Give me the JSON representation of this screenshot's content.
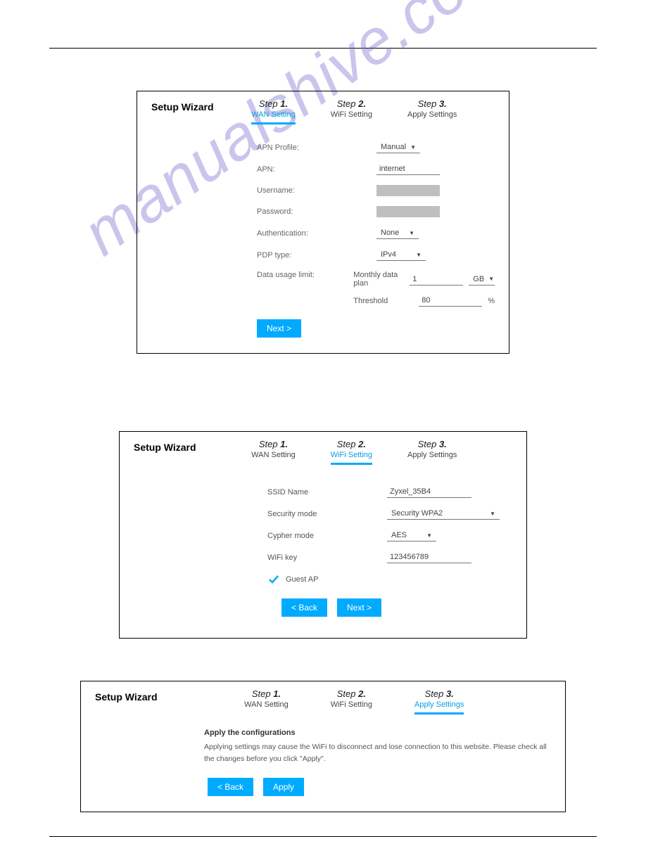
{
  "watermark": "manualshive.com",
  "wizard_title": "Setup Wizard",
  "steps": {
    "s1": {
      "label": "Step",
      "num": "1.",
      "sub": "WAN Setting"
    },
    "s2": {
      "label": "Step",
      "num": "2.",
      "sub": "WiFi Setting"
    },
    "s3": {
      "label": "Step",
      "num": "3.",
      "sub": "Apply Settings"
    }
  },
  "panel1": {
    "labels": {
      "apn_profile": "APN Profile:",
      "apn": "APN:",
      "username": "Username:",
      "password": "Password:",
      "auth": "Authentication:",
      "pdp": "PDP type:",
      "data_limit": "Data usage limit:",
      "monthly": "Monthly data plan",
      "threshold": "Threshold"
    },
    "values": {
      "apn_profile": "Manual",
      "apn": "internet",
      "auth": "None",
      "pdp": "IPv4",
      "monthly_value": "1",
      "monthly_unit": "GB",
      "threshold_value": "80",
      "threshold_unit": "%"
    },
    "next": "Next >"
  },
  "panel2": {
    "labels": {
      "ssid": "SSID Name",
      "security": "Security mode",
      "cypher": "Cypher mode",
      "wifikey": "WiFi key",
      "guest": "Guest AP"
    },
    "values": {
      "ssid": "Zyxel_35B4",
      "security": "Security WPA2",
      "cypher": "AES",
      "wifikey": "123456789"
    },
    "back": "< Back",
    "next": "Next >"
  },
  "panel3": {
    "title": "Apply the configurations",
    "body": "Applying settings may cause the WiFi to disconnect and lose connection to this website. Please check all the changes before you click \"Apply\".",
    "back": "< Back",
    "apply": "Apply"
  }
}
